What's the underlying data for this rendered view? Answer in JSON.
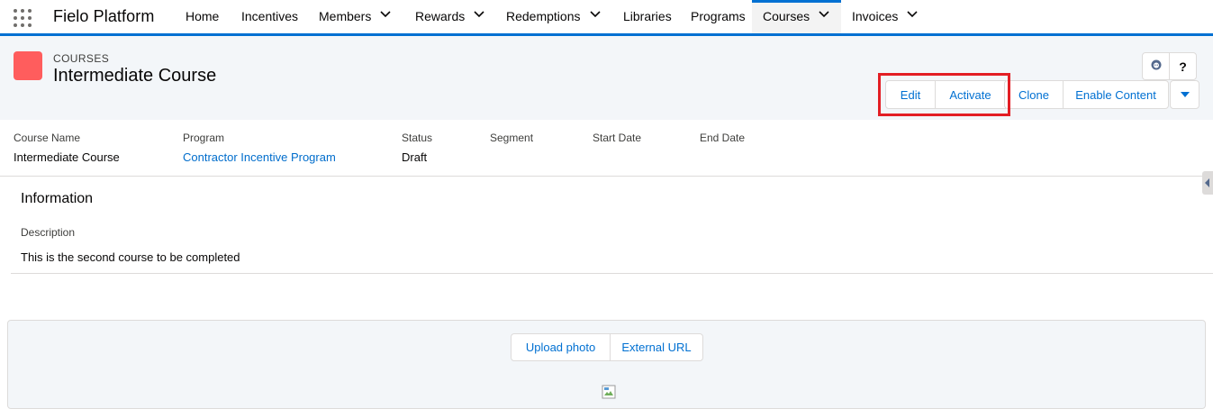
{
  "app": {
    "name": "Fielo Platform",
    "launcher_icon": "app-launcher-icon"
  },
  "nav": {
    "items": [
      {
        "label": "Home",
        "dropdown": false
      },
      {
        "label": "Incentives",
        "dropdown": false
      },
      {
        "label": "Members",
        "dropdown": true
      },
      {
        "label": "Rewards",
        "dropdown": true
      },
      {
        "label": "Redemptions",
        "dropdown": true
      },
      {
        "label": "Libraries",
        "dropdown": false
      },
      {
        "label": "Programs",
        "dropdown": false
      },
      {
        "label": "Courses",
        "dropdown": true,
        "active": true
      },
      {
        "label": "Invoices",
        "dropdown": true
      }
    ]
  },
  "record": {
    "object_type": "COURSES",
    "title": "Intermediate Course",
    "icon_color": "#ff5d5d",
    "utility": {
      "left_icon": "agent-icon",
      "help_label": "?"
    },
    "actions": {
      "edit": "Edit",
      "activate": "Activate",
      "clone": "Clone",
      "enable_content": "Enable Content",
      "more_icon": "caret-down-icon"
    }
  },
  "highlights": {
    "course_name": {
      "label": "Course Name",
      "value": "Intermediate Course"
    },
    "program": {
      "label": "Program",
      "value": "Contractor Incentive Program"
    },
    "status": {
      "label": "Status",
      "value": "Draft"
    },
    "segment": {
      "label": "Segment",
      "value": ""
    },
    "start_date": {
      "label": "Start Date",
      "value": ""
    },
    "end_date": {
      "label": "End Date",
      "value": ""
    }
  },
  "information": {
    "title": "Information",
    "description_label": "Description",
    "description_value": "This is the second course to be completed"
  },
  "photo": {
    "upload_label": "Upload photo",
    "external_label": "External URL"
  },
  "colors": {
    "brand": "#0070d2",
    "link": "#006dcc",
    "highlight": "#e31e24",
    "header_bg": "#f3f6f9"
  }
}
